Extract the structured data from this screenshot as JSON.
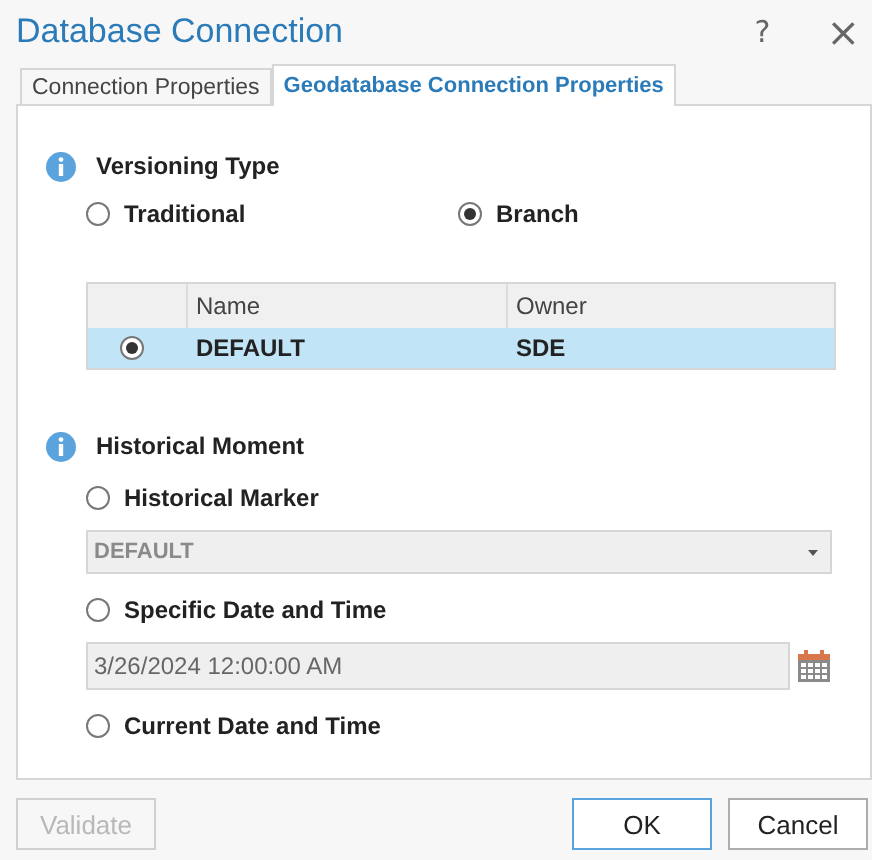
{
  "window": {
    "title": "Database Connection",
    "help": "?",
    "close": "×"
  },
  "tabs": [
    {
      "label": "Connection Properties",
      "selected": false
    },
    {
      "label": "Geodatabase Connection Properties",
      "selected": true
    }
  ],
  "versioning": {
    "heading": "Versioning Type",
    "options": [
      {
        "label": "Traditional",
        "selected": false
      },
      {
        "label": "Branch",
        "selected": true
      }
    ]
  },
  "versions_table": {
    "columns": [
      "Name",
      "Owner"
    ],
    "rows": [
      {
        "name": "DEFAULT",
        "owner": "SDE",
        "selected": true
      }
    ]
  },
  "historical": {
    "heading": "Historical Moment",
    "items": [
      {
        "kind": "radio",
        "label": "Historical Marker",
        "selected": false
      },
      {
        "kind": "dropdown",
        "value": "DEFAULT",
        "disabled": true
      },
      {
        "kind": "radio",
        "label": "Specific Date and Time",
        "selected": false
      },
      {
        "kind": "date",
        "value": "3/26/2024 12:00:00 AM",
        "disabled": true
      },
      {
        "kind": "radio",
        "label": "Current Date and Time",
        "selected": false
      }
    ]
  },
  "buttons": [
    {
      "label": "Validate",
      "disabled": true,
      "primary": false
    },
    {
      "label": "OK",
      "disabled": false,
      "primary": true
    },
    {
      "label": "Cancel",
      "disabled": false,
      "primary": false
    }
  ]
}
